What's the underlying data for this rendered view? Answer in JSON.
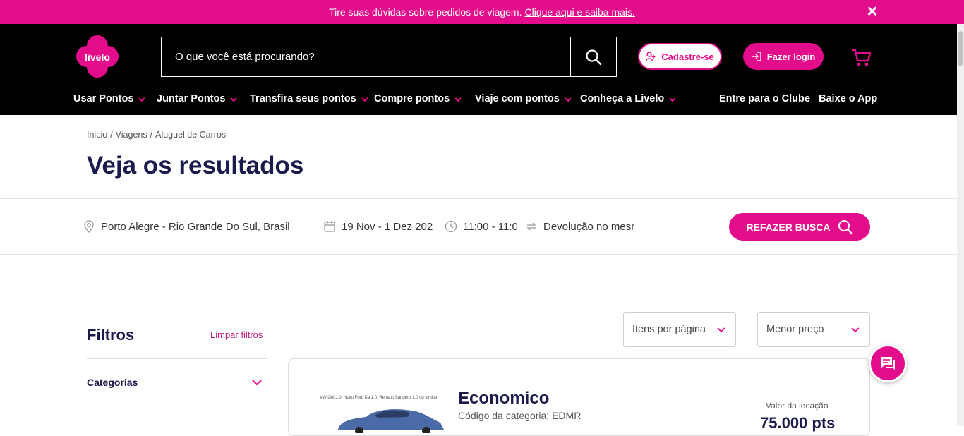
{
  "announcement": {
    "text": "Tire suas dúvidas sobre pedidos de viagem.",
    "link": "Clique aqui e saiba mais."
  },
  "header": {
    "logo_text": "livelo",
    "search_placeholder": "O que você está procurando?",
    "signup_label": "Cadastre-se",
    "login_label": "Fazer login"
  },
  "nav": {
    "items": [
      "Usar Pontos",
      "Juntar Pontos",
      "Transfira seus pontos",
      "Compre pontos",
      "Viaje com pontos",
      "Conheça a Livelo"
    ],
    "right": [
      "Entre para o Clube",
      "Baixe o App"
    ]
  },
  "breadcrumb": [
    "Inicio",
    "Viagens",
    "Aluguel de Carros"
  ],
  "page_title": "Veja os resultados",
  "search_summary": {
    "location": "Porto Alegre - Rio Grande Do Sul, Brasil",
    "dates": "19 Nov - 1 Dez 202",
    "times": "11:00 - 11:0",
    "return": "Devolução no mesr",
    "button": "REFAZER BUSCA"
  },
  "filters": {
    "title": "Filtros",
    "clear": "Limpar filtros",
    "sections": [
      "Categorias"
    ]
  },
  "sort": {
    "per_page": "Itens por página",
    "order": "Menor preço"
  },
  "result": {
    "image_caption": "VW Gol 1.0, Novo Ford Ka 1.0, Renault Sandero 1.0 ou similar",
    "name": "Economico",
    "code": "Código da categoria: EDMR",
    "price_label": "Valor da locação",
    "price": "75.000 pts"
  },
  "colors": {
    "brand": "#e30d8c",
    "navy": "#1b1b4d",
    "header_bg": "#000000"
  }
}
